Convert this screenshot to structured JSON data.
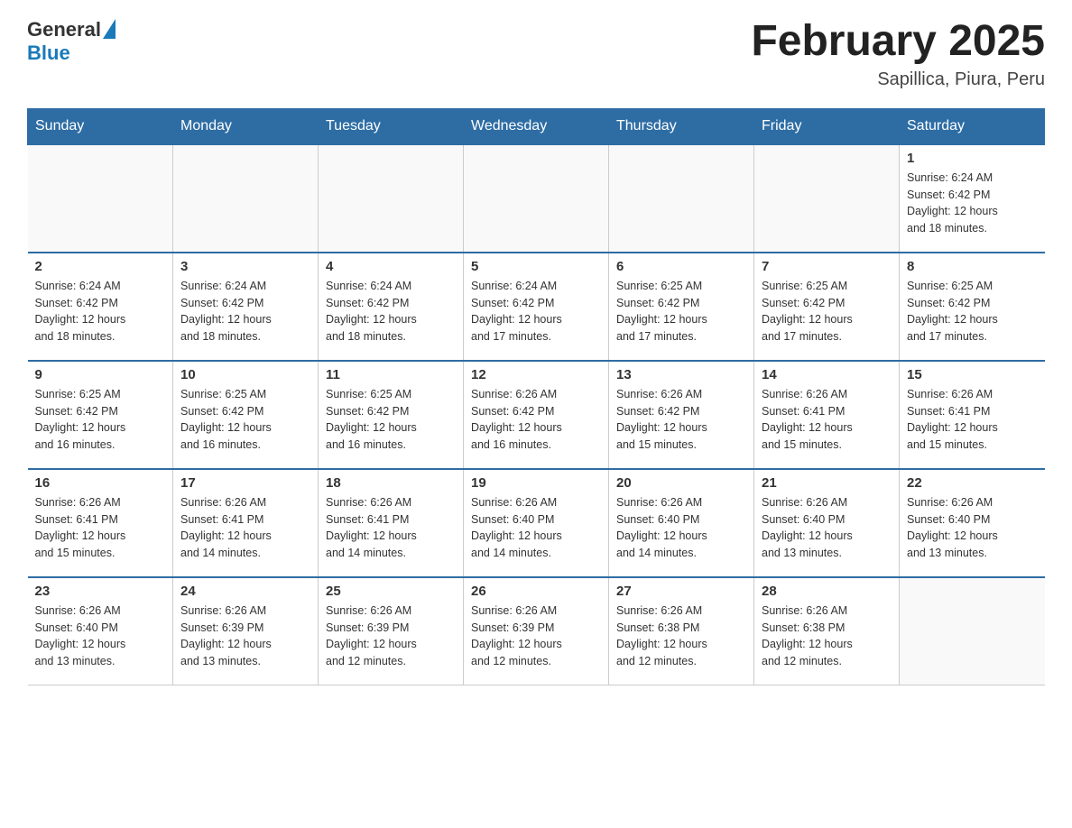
{
  "header": {
    "logo_general": "General",
    "logo_blue": "Blue",
    "month_title": "February 2025",
    "location": "Sapillica, Piura, Peru"
  },
  "days_of_week": [
    "Sunday",
    "Monday",
    "Tuesday",
    "Wednesday",
    "Thursday",
    "Friday",
    "Saturday"
  ],
  "weeks": [
    [
      {
        "day": "",
        "info": ""
      },
      {
        "day": "",
        "info": ""
      },
      {
        "day": "",
        "info": ""
      },
      {
        "day": "",
        "info": ""
      },
      {
        "day": "",
        "info": ""
      },
      {
        "day": "",
        "info": ""
      },
      {
        "day": "1",
        "info": "Sunrise: 6:24 AM\nSunset: 6:42 PM\nDaylight: 12 hours\nand 18 minutes."
      }
    ],
    [
      {
        "day": "2",
        "info": "Sunrise: 6:24 AM\nSunset: 6:42 PM\nDaylight: 12 hours\nand 18 minutes."
      },
      {
        "day": "3",
        "info": "Sunrise: 6:24 AM\nSunset: 6:42 PM\nDaylight: 12 hours\nand 18 minutes."
      },
      {
        "day": "4",
        "info": "Sunrise: 6:24 AM\nSunset: 6:42 PM\nDaylight: 12 hours\nand 18 minutes."
      },
      {
        "day": "5",
        "info": "Sunrise: 6:24 AM\nSunset: 6:42 PM\nDaylight: 12 hours\nand 17 minutes."
      },
      {
        "day": "6",
        "info": "Sunrise: 6:25 AM\nSunset: 6:42 PM\nDaylight: 12 hours\nand 17 minutes."
      },
      {
        "day": "7",
        "info": "Sunrise: 6:25 AM\nSunset: 6:42 PM\nDaylight: 12 hours\nand 17 minutes."
      },
      {
        "day": "8",
        "info": "Sunrise: 6:25 AM\nSunset: 6:42 PM\nDaylight: 12 hours\nand 17 minutes."
      }
    ],
    [
      {
        "day": "9",
        "info": "Sunrise: 6:25 AM\nSunset: 6:42 PM\nDaylight: 12 hours\nand 16 minutes."
      },
      {
        "day": "10",
        "info": "Sunrise: 6:25 AM\nSunset: 6:42 PM\nDaylight: 12 hours\nand 16 minutes."
      },
      {
        "day": "11",
        "info": "Sunrise: 6:25 AM\nSunset: 6:42 PM\nDaylight: 12 hours\nand 16 minutes."
      },
      {
        "day": "12",
        "info": "Sunrise: 6:26 AM\nSunset: 6:42 PM\nDaylight: 12 hours\nand 16 minutes."
      },
      {
        "day": "13",
        "info": "Sunrise: 6:26 AM\nSunset: 6:42 PM\nDaylight: 12 hours\nand 15 minutes."
      },
      {
        "day": "14",
        "info": "Sunrise: 6:26 AM\nSunset: 6:41 PM\nDaylight: 12 hours\nand 15 minutes."
      },
      {
        "day": "15",
        "info": "Sunrise: 6:26 AM\nSunset: 6:41 PM\nDaylight: 12 hours\nand 15 minutes."
      }
    ],
    [
      {
        "day": "16",
        "info": "Sunrise: 6:26 AM\nSunset: 6:41 PM\nDaylight: 12 hours\nand 15 minutes."
      },
      {
        "day": "17",
        "info": "Sunrise: 6:26 AM\nSunset: 6:41 PM\nDaylight: 12 hours\nand 14 minutes."
      },
      {
        "day": "18",
        "info": "Sunrise: 6:26 AM\nSunset: 6:41 PM\nDaylight: 12 hours\nand 14 minutes."
      },
      {
        "day": "19",
        "info": "Sunrise: 6:26 AM\nSunset: 6:40 PM\nDaylight: 12 hours\nand 14 minutes."
      },
      {
        "day": "20",
        "info": "Sunrise: 6:26 AM\nSunset: 6:40 PM\nDaylight: 12 hours\nand 14 minutes."
      },
      {
        "day": "21",
        "info": "Sunrise: 6:26 AM\nSunset: 6:40 PM\nDaylight: 12 hours\nand 13 minutes."
      },
      {
        "day": "22",
        "info": "Sunrise: 6:26 AM\nSunset: 6:40 PM\nDaylight: 12 hours\nand 13 minutes."
      }
    ],
    [
      {
        "day": "23",
        "info": "Sunrise: 6:26 AM\nSunset: 6:40 PM\nDaylight: 12 hours\nand 13 minutes."
      },
      {
        "day": "24",
        "info": "Sunrise: 6:26 AM\nSunset: 6:39 PM\nDaylight: 12 hours\nand 13 minutes."
      },
      {
        "day": "25",
        "info": "Sunrise: 6:26 AM\nSunset: 6:39 PM\nDaylight: 12 hours\nand 12 minutes."
      },
      {
        "day": "26",
        "info": "Sunrise: 6:26 AM\nSunset: 6:39 PM\nDaylight: 12 hours\nand 12 minutes."
      },
      {
        "day": "27",
        "info": "Sunrise: 6:26 AM\nSunset: 6:38 PM\nDaylight: 12 hours\nand 12 minutes."
      },
      {
        "day": "28",
        "info": "Sunrise: 6:26 AM\nSunset: 6:38 PM\nDaylight: 12 hours\nand 12 minutes."
      },
      {
        "day": "",
        "info": ""
      }
    ]
  ]
}
